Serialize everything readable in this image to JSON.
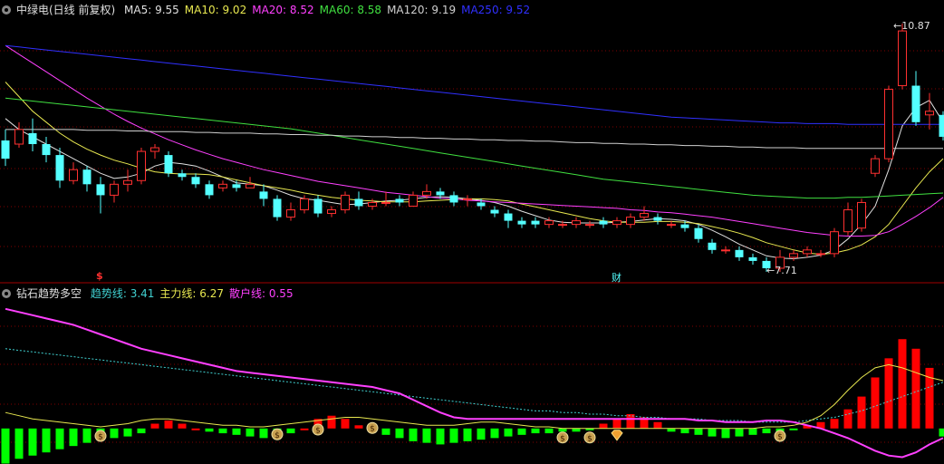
{
  "main_header": {
    "title": "中绿电(日线 前复权)",
    "ma_items": [
      {
        "label": "MA5: 9.55",
        "color": "#e0e0e0"
      },
      {
        "label": "MA10: 9.02",
        "color": "#e8e850"
      },
      {
        "label": "MA20: 8.52",
        "color": "#ff40ff"
      },
      {
        "label": "MA60: 8.58",
        "color": "#40e040"
      },
      {
        "label": "MA120: 9.19",
        "color": "#d0d0d0"
      },
      {
        "label": "MA250: 9.52",
        "color": "#3030ff"
      }
    ]
  },
  "indicator_header": {
    "title": "钻石趋势多空",
    "items": [
      {
        "label": "趋势线: 3.41",
        "color": "#40d0d0"
      },
      {
        "label": "主力线: 6.27",
        "color": "#e8e850"
      },
      {
        "label": "散户线: 0.55",
        "color": "#ff40ff"
      }
    ]
  },
  "annotations": {
    "high_price": "10.87",
    "low_price": "7.71",
    "dollar_marker": "$",
    "finance_marker": "财"
  },
  "colors": {
    "up": "#ff3030",
    "down": "#54ffff",
    "grid": "#800000",
    "ma5": "#e0e0e0",
    "ma10": "#e8e850",
    "ma20": "#ff40ff",
    "ma60": "#40e040",
    "ma120": "#d0d0d0",
    "ma250": "#3030ff",
    "trend": "#40d0d0",
    "main_line": "#e8e850",
    "retail_line": "#ff40ff",
    "bull_bar": "#ff0000",
    "bear_bar": "#00ff00"
  },
  "chart_data": {
    "type": "candlestick",
    "price_range": [
      7.5,
      11.0
    ],
    "candles": [
      [
        9.3,
        9.05,
        9.45,
        8.95
      ],
      [
        9.25,
        9.45,
        9.55,
        9.2
      ],
      [
        9.4,
        9.25,
        9.6,
        9.15
      ],
      [
        9.25,
        9.1,
        9.35,
        9.0
      ],
      [
        9.1,
        8.75,
        9.2,
        8.65
      ],
      [
        8.75,
        8.9,
        9.0,
        8.7
      ],
      [
        8.9,
        8.7,
        8.95,
        8.6
      ],
      [
        8.7,
        8.55,
        8.8,
        8.3
      ],
      [
        8.55,
        8.7,
        8.75,
        8.45
      ],
      [
        8.7,
        8.75,
        8.9,
        8.6
      ],
      [
        8.75,
        9.15,
        9.2,
        8.7
      ],
      [
        9.15,
        9.2,
        9.25,
        9.05
      ],
      [
        9.1,
        8.85,
        9.15,
        8.8
      ],
      [
        8.85,
        8.8,
        8.9,
        8.75
      ],
      [
        8.8,
        8.7,
        8.85,
        8.65
      ],
      [
        8.7,
        8.55,
        8.75,
        8.5
      ],
      [
        8.65,
        8.7,
        8.75,
        8.6
      ],
      [
        8.7,
        8.65,
        8.75,
        8.6
      ],
      [
        8.65,
        8.7,
        8.8,
        8.65
      ],
      [
        8.6,
        8.5,
        8.7,
        8.4
      ],
      [
        8.5,
        8.25,
        8.55,
        8.2
      ],
      [
        8.25,
        8.35,
        8.45,
        8.2
      ],
      [
        8.35,
        8.5,
        8.55,
        8.3
      ],
      [
        8.5,
        8.3,
        8.55,
        8.25
      ],
      [
        8.3,
        8.35,
        8.4,
        8.25
      ],
      [
        8.35,
        8.55,
        8.6,
        8.3
      ],
      [
        8.5,
        8.4,
        8.6,
        8.35
      ],
      [
        8.4,
        8.45,
        8.5,
        8.35
      ],
      [
        8.45,
        8.45,
        8.6,
        8.4
      ],
      [
        8.5,
        8.45,
        8.55,
        8.4
      ],
      [
        8.4,
        8.55,
        8.6,
        8.4
      ],
      [
        8.55,
        8.6,
        8.7,
        8.5
      ],
      [
        8.6,
        8.55,
        8.65,
        8.5
      ],
      [
        8.55,
        8.45,
        8.6,
        8.4
      ],
      [
        8.5,
        8.5,
        8.55,
        8.4
      ],
      [
        8.45,
        8.4,
        8.5,
        8.35
      ],
      [
        8.35,
        8.3,
        8.4,
        8.25
      ],
      [
        8.3,
        8.2,
        8.35,
        8.1
      ],
      [
        8.2,
        8.15,
        8.25,
        8.1
      ],
      [
        8.2,
        8.15,
        8.25,
        8.1
      ],
      [
        8.15,
        8.2,
        8.25,
        8.1
      ],
      [
        8.15,
        8.15,
        8.2,
        8.1
      ],
      [
        8.15,
        8.2,
        8.25,
        8.1
      ],
      [
        8.15,
        8.15,
        8.2,
        8.1
      ],
      [
        8.2,
        8.15,
        8.25,
        8.1
      ],
      [
        8.15,
        8.2,
        8.25,
        8.1
      ],
      [
        8.15,
        8.25,
        8.3,
        8.1
      ],
      [
        8.25,
        8.3,
        8.4,
        8.2
      ],
      [
        8.25,
        8.2,
        8.3,
        8.15
      ],
      [
        8.15,
        8.15,
        8.2,
        8.1
      ],
      [
        8.15,
        8.1,
        8.2,
        8.05
      ],
      [
        8.1,
        7.95,
        8.15,
        7.9
      ],
      [
        7.9,
        7.8,
        7.95,
        7.75
      ],
      [
        7.8,
        7.8,
        7.85,
        7.75
      ],
      [
        7.8,
        7.7,
        7.85,
        7.65
      ],
      [
        7.7,
        7.65,
        7.75,
        7.6
      ],
      [
        7.65,
        7.55,
        7.7,
        7.5
      ],
      [
        7.55,
        7.7,
        7.8,
        7.5
      ],
      [
        7.7,
        7.75,
        7.8,
        7.65
      ],
      [
        7.75,
        7.8,
        7.85,
        7.7
      ],
      [
        7.75,
        7.75,
        7.8,
        7.7
      ],
      [
        7.75,
        8.05,
        8.1,
        7.7
      ],
      [
        8.05,
        8.35,
        8.45,
        8.0
      ],
      [
        8.1,
        8.45,
        8.5,
        8.05
      ],
      [
        8.85,
        9.05,
        9.1,
        8.8
      ],
      [
        9.05,
        10.0,
        10.05,
        9.0
      ],
      [
        10.05,
        10.8,
        10.9,
        10.0
      ],
      [
        10.05,
        9.55,
        10.25,
        9.5
      ],
      [
        9.65,
        9.7,
        9.95,
        9.45
      ],
      [
        9.65,
        9.35,
        9.7,
        9.3
      ]
    ],
    "ma_series": {
      "MA5": [
        9.6,
        9.45,
        9.35,
        9.25,
        9.15,
        9.05,
        8.95,
        8.85,
        8.78,
        8.8,
        8.85,
        8.95,
        9.0,
        8.98,
        8.95,
        8.88,
        8.8,
        8.72,
        8.7,
        8.68,
        8.62,
        8.55,
        8.5,
        8.48,
        8.45,
        8.42,
        8.43,
        8.45,
        8.47,
        8.48,
        8.5,
        8.52,
        8.53,
        8.52,
        8.5,
        8.48,
        8.45,
        8.4,
        8.33,
        8.27,
        8.21,
        8.18,
        8.17,
        8.17,
        8.17,
        8.18,
        8.19,
        8.21,
        8.23,
        8.22,
        8.2,
        8.15,
        8.07,
        7.98,
        7.88,
        7.8,
        7.72,
        7.69,
        7.68,
        7.7,
        7.73,
        7.8,
        7.95,
        8.15,
        8.4,
        8.9,
        9.5,
        9.75,
        9.85,
        9.55
      ],
      "MA10": [
        10.1,
        9.9,
        9.7,
        9.55,
        9.4,
        9.28,
        9.18,
        9.1,
        9.03,
        8.98,
        8.92,
        8.87,
        8.85,
        8.84,
        8.84,
        8.83,
        8.8,
        8.76,
        8.72,
        8.68,
        8.65,
        8.62,
        8.58,
        8.55,
        8.52,
        8.5,
        8.48,
        8.47,
        8.46,
        8.46,
        8.46,
        8.47,
        8.48,
        8.49,
        8.5,
        8.5,
        8.49,
        8.47,
        8.43,
        8.39,
        8.35,
        8.31,
        8.27,
        8.23,
        8.2,
        8.18,
        8.18,
        8.18,
        8.19,
        8.19,
        8.18,
        8.16,
        8.12,
        8.08,
        8.03,
        7.97,
        7.9,
        7.85,
        7.8,
        7.76,
        7.74,
        7.76,
        7.8,
        7.87,
        7.98,
        8.15,
        8.4,
        8.65,
        8.87,
        9.05
      ],
      "MA20": [
        10.6,
        10.48,
        10.36,
        10.24,
        10.12,
        10.0,
        9.88,
        9.77,
        9.66,
        9.56,
        9.47,
        9.39,
        9.31,
        9.24,
        9.17,
        9.11,
        9.05,
        9.0,
        8.95,
        8.9,
        8.86,
        8.82,
        8.78,
        8.74,
        8.71,
        8.68,
        8.65,
        8.62,
        8.59,
        8.57,
        8.55,
        8.53,
        8.51,
        8.5,
        8.48,
        8.47,
        8.46,
        8.45,
        8.44,
        8.43,
        8.42,
        8.41,
        8.4,
        8.39,
        8.38,
        8.37,
        8.35,
        8.34,
        8.32,
        8.31,
        8.29,
        8.27,
        8.25,
        8.22,
        8.19,
        8.16,
        8.13,
        8.1,
        8.07,
        8.04,
        8.02,
        8.0,
        7.99,
        7.99,
        8.0,
        8.05,
        8.15,
        8.26,
        8.38,
        8.52
      ],
      "MA60": [
        9.88,
        9.86,
        9.84,
        9.82,
        9.8,
        9.78,
        9.76,
        9.74,
        9.72,
        9.7,
        9.68,
        9.66,
        9.64,
        9.62,
        9.6,
        9.58,
        9.56,
        9.54,
        9.52,
        9.5,
        9.48,
        9.46,
        9.43,
        9.4,
        9.37,
        9.34,
        9.31,
        9.28,
        9.25,
        9.22,
        9.19,
        9.16,
        9.13,
        9.1,
        9.07,
        9.04,
        9.01,
        8.98,
        8.95,
        8.92,
        8.89,
        8.86,
        8.83,
        8.8,
        8.77,
        8.75,
        8.73,
        8.71,
        8.69,
        8.67,
        8.65,
        8.63,
        8.61,
        8.59,
        8.57,
        8.55,
        8.54,
        8.53,
        8.52,
        8.51,
        8.51,
        8.51,
        8.52,
        8.52,
        8.53,
        8.54,
        8.55,
        8.56,
        8.57,
        8.58
      ],
      "MA120": [
        9.45,
        9.45,
        9.45,
        9.45,
        9.45,
        9.45,
        9.44,
        9.44,
        9.44,
        9.43,
        9.43,
        9.42,
        9.42,
        9.42,
        9.41,
        9.41,
        9.4,
        9.4,
        9.4,
        9.39,
        9.39,
        9.38,
        9.38,
        9.37,
        9.37,
        9.36,
        9.36,
        9.35,
        9.35,
        9.34,
        9.34,
        9.33,
        9.33,
        9.32,
        9.32,
        9.31,
        9.31,
        9.3,
        9.3,
        9.29,
        9.29,
        9.28,
        9.27,
        9.27,
        9.26,
        9.26,
        9.25,
        9.25,
        9.24,
        9.24,
        9.23,
        9.23,
        9.22,
        9.22,
        9.21,
        9.21,
        9.2,
        9.2,
        9.2,
        9.19,
        9.19,
        9.19,
        9.19,
        9.19,
        9.19,
        9.19,
        9.19,
        9.19,
        9.19,
        9.19
      ],
      "MA250": [
        10.6,
        10.58,
        10.56,
        10.54,
        10.52,
        10.5,
        10.48,
        10.46,
        10.44,
        10.42,
        10.4,
        10.38,
        10.36,
        10.34,
        10.32,
        10.3,
        10.28,
        10.26,
        10.24,
        10.22,
        10.2,
        10.18,
        10.16,
        10.14,
        10.12,
        10.1,
        10.08,
        10.06,
        10.04,
        10.02,
        10.0,
        9.98,
        9.96,
        9.94,
        9.92,
        9.9,
        9.88,
        9.86,
        9.84,
        9.82,
        9.8,
        9.78,
        9.76,
        9.74,
        9.72,
        9.7,
        9.68,
        9.66,
        9.64,
        9.62,
        9.61,
        9.6,
        9.59,
        9.58,
        9.57,
        9.56,
        9.55,
        9.54,
        9.54,
        9.53,
        9.53,
        9.53,
        9.52,
        9.52,
        9.52,
        9.52,
        9.52,
        9.52,
        9.52,
        9.52
      ]
    },
    "indicator": {
      "range": [
        0,
        100
      ],
      "retail_line": [
        95,
        93,
        91,
        89,
        87,
        85,
        82,
        79,
        76,
        73,
        70,
        68,
        66,
        64,
        62,
        60,
        58,
        56,
        55,
        54,
        53,
        52,
        51,
        50,
        49,
        48,
        47,
        46,
        44,
        42,
        38,
        34,
        30,
        27,
        26,
        26,
        26,
        26,
        26,
        26,
        26,
        26,
        26,
        26,
        26,
        26,
        26,
        26,
        26,
        26,
        26,
        25,
        25,
        24,
        24,
        24,
        25,
        25,
        24,
        22,
        20,
        17,
        14,
        10,
        6,
        3,
        2,
        5,
        10,
        14
      ],
      "trend_line": [
        70,
        69,
        68,
        67,
        66,
        65,
        64,
        63,
        62,
        61,
        60,
        59,
        58,
        57,
        56,
        55,
        54,
        53,
        52,
        51,
        50,
        49,
        48,
        47,
        46,
        45,
        44,
        43,
        42,
        41,
        40,
        39,
        38,
        37,
        36,
        35,
        34,
        33,
        32,
        31,
        31,
        30,
        30,
        29,
        29,
        28,
        28,
        27,
        27,
        26,
        26,
        26,
        25,
        25,
        25,
        24,
        24,
        24,
        24,
        25,
        26,
        27,
        29,
        31,
        34,
        37,
        40,
        43,
        46,
        49
      ],
      "main_line": [
        30,
        28,
        26,
        25,
        24,
        23,
        22,
        21,
        22,
        23,
        25,
        26,
        26,
        25,
        24,
        23,
        22,
        22,
        21,
        21,
        22,
        23,
        24,
        25,
        26,
        27,
        27,
        26,
        25,
        24,
        23,
        22,
        22,
        22,
        23,
        24,
        24,
        23,
        22,
        21,
        21,
        20,
        20,
        20,
        20,
        20,
        20,
        20,
        20,
        20,
        20,
        20,
        20,
        20,
        20,
        20,
        21,
        21,
        22,
        24,
        28,
        35,
        44,
        52,
        58,
        60,
        58,
        55,
        52,
        50
      ],
      "bars": [
        -22,
        -19,
        -17,
        -15,
        -13,
        -11,
        -9,
        -7,
        -6,
        -5,
        -3,
        3,
        5,
        3,
        0,
        -2,
        -3,
        -4,
        -5,
        -6,
        -5,
        -3,
        0,
        6,
        8,
        6,
        2,
        -1,
        -4,
        -6,
        -8,
        -9,
        -10,
        -9,
        -8,
        -7,
        -6,
        -5,
        -4,
        -3,
        -3,
        -2,
        -2,
        -1,
        3,
        6,
        9,
        7,
        4,
        -2,
        -3,
        -4,
        -5,
        -6,
        -5,
        -4,
        -3,
        -2,
        -1,
        2,
        4,
        6,
        12,
        20,
        32,
        44,
        56,
        50,
        38,
        -5
      ],
      "coin_markers": [
        7,
        20,
        23,
        27,
        41,
        43,
        57
      ],
      "diamond_marker": 45
    }
  }
}
